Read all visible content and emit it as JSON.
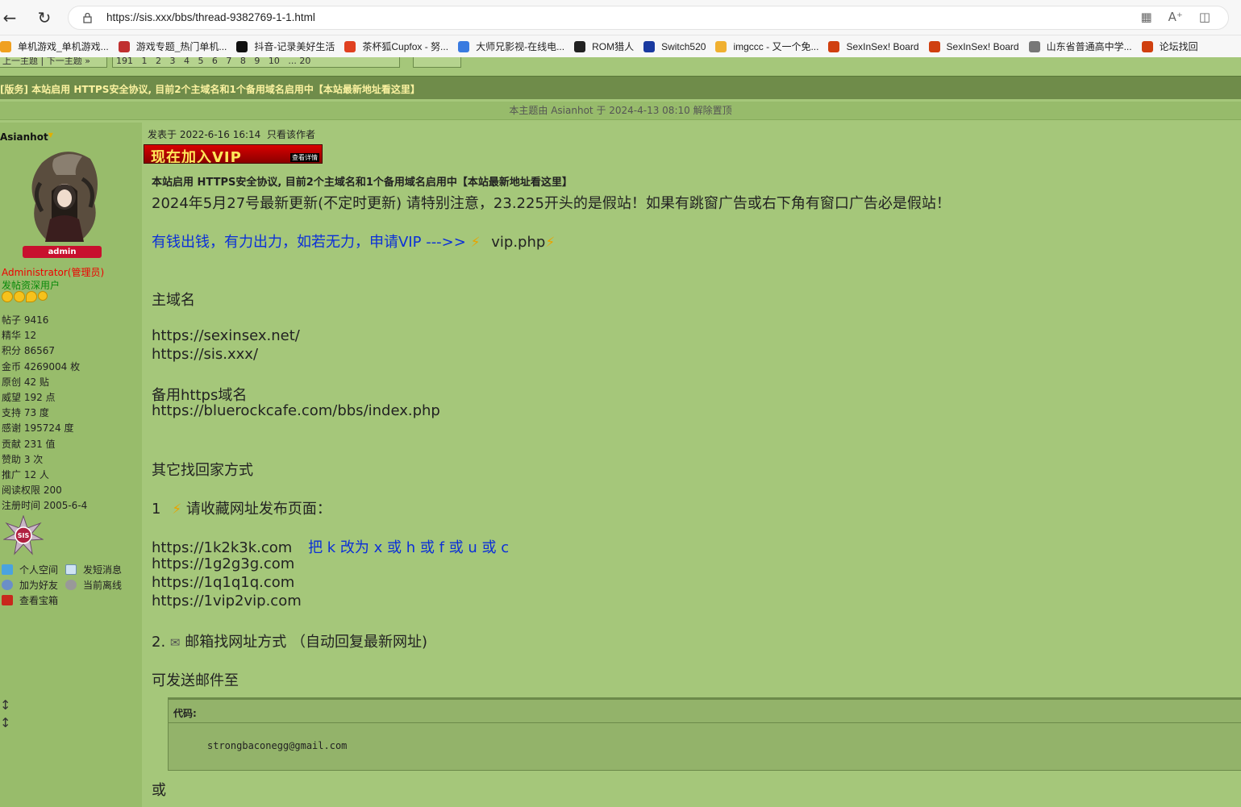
{
  "browser": {
    "url": "https://sis.xxx/bbs/thread-9382769-1-1.html",
    "bookmarks": [
      {
        "label": "单机游戏_单机游戏...",
        "color": "#f0a020"
      },
      {
        "label": "游戏专题_热门单机...",
        "color": "#c03030"
      },
      {
        "label": "抖音-记录美好生活",
        "color": "#111111"
      },
      {
        "label": "茶杯狐Cupfox - 努...",
        "color": "#e04020"
      },
      {
        "label": "大师兄影视-在线电...",
        "color": "#3a7be0"
      },
      {
        "label": "ROM猎人",
        "color": "#222222"
      },
      {
        "label": "Switch520",
        "color": "#1a3aa0"
      },
      {
        "label": "imgccc - 又一个免...",
        "color": "#f0b030"
      },
      {
        "label": "SexInSex! Board",
        "color": "#d04010"
      },
      {
        "label": "SexInSex! Board",
        "color": "#d04010"
      },
      {
        "label": "山东省普通高中学...",
        "color": "#777777"
      },
      {
        "label": "论坛找回",
        "color": "#d04010"
      }
    ]
  },
  "forum": {
    "thread_title": "[版务] 本站启用 HTTPS安全协议, 目前2个主域名和1个备用域名启用中【本站最新地址看这里】",
    "moderation": "本主题由 Asianhot 于 2024-4-13 08:10 解除置顶"
  },
  "author": {
    "name": "Asianhot",
    "badge": "admin",
    "role": "Administrator(管理员)",
    "rank": "发帖资深用户",
    "stats": [
      "帖子  9416",
      "精华  12",
      "积分  86567",
      "金币  4269004 枚",
      "原创  42 贴",
      "威望  192 点",
      "支持  73 度",
      "感谢  195724 度",
      "贡献  231 值",
      "赞助  3 次",
      "推广  12 人",
      "阅读权限  200",
      "注册时间  2005-6-4"
    ],
    "actions": {
      "space": "个人空间",
      "message": "发短消息",
      "friend": "加为好友",
      "online": "当前离线",
      "treasure": "查看宝箱"
    }
  },
  "post": {
    "meta_time": "发表于 2022-6-16 16:14",
    "meta_author_only": "只看该作者",
    "vip_banner": "现在加入VIP",
    "vip_banner_sub": "查看详情",
    "title": "本站启用 HTTPS安全协议, 目前2个主域名和1个备用域名启用中【本站最新地址看这里】",
    "update_notice": "2024年5月27号最新更新(不定时更新) 请特别注意，23.225开头的是假站！如果有跳窗广告或右下角有窗口广告必是假站！",
    "vip_line": "有钱出钱，有力出力，如若无力，申请VIP --->> ",
    "vip_link": "vip.php",
    "main_domain_heading": "主域名",
    "domain1": "https://sexinsex.net/",
    "domain2": "https://sis.xxx/",
    "backup_heading": "备用https域名",
    "backup_domain": "https://bluerockcafe.com/bbs/index.php",
    "other_heading": "其它找回家方式",
    "step1_num": "1",
    "step1_text": "请收藏网址发布页面：",
    "release1": "https://1k2k3k.com",
    "release1_note": "把 k 改为 x 或 h 或 f 或 u 或 c",
    "release2": "https://1g2g3g.com",
    "release3": "https://1q1q1q.com",
    "release4": "https://1vip2vip.com",
    "step2_num": "2.",
    "step2_text": "邮箱找网址方式  （自动回复最新网址)",
    "send_to": "可发送邮件至",
    "code_label": "代码:",
    "email": "strongbaconegg@gmail.com",
    "or": "或"
  }
}
